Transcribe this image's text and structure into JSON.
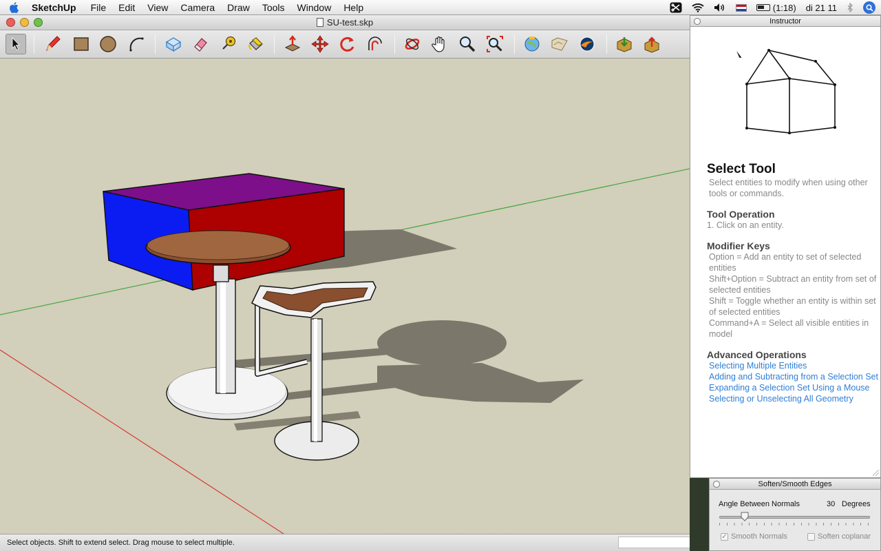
{
  "menubar": {
    "app": "SketchUp",
    "items": [
      "File",
      "Edit",
      "View",
      "Camera",
      "Draw",
      "Tools",
      "Window",
      "Help"
    ],
    "battery": "(1:18)",
    "clock": "di 21 11"
  },
  "window": {
    "title": "SU-test.skp"
  },
  "toolbar": {
    "tools": [
      "Select",
      "Line",
      "Rectangle",
      "Circle",
      "Arc",
      "Make Component",
      "Eraser",
      "Tape Measure",
      "Paint Bucket",
      "Push/Pull",
      "Move",
      "Rotate",
      "Offset",
      "Orbit",
      "Pan",
      "Zoom",
      "Zoom Extents",
      "Get Current View",
      "Toggle Terrain",
      "Place Model",
      "Get Models",
      "Share Model"
    ]
  },
  "status": {
    "text": "Select objects. Shift to extend select. Drag mouse to select multiple."
  },
  "instructor": {
    "panel_title": "Instructor",
    "tool_title": "Select Tool",
    "tool_desc": "Select entities to modify when using other tools or commands.",
    "operation_heading": "Tool Operation",
    "operation_step": "1.  Click on an entity.",
    "modifier_heading": "Modifier Keys",
    "modifiers": [
      "Option = Add an entity to set of selected entities",
      "Shift+Option = Subtract an entity from set of selected entities",
      "Shift = Toggle whether an entity is within set of selected entities",
      "Command+A = Select all visible entities in model"
    ],
    "advanced_heading": "Advanced Operations",
    "links": [
      "Selecting Multiple Entities",
      "Adding and Subtracting from a Selection Set",
      "Expanding a Selection Set Using a Mouse",
      "Selecting or Unselecting All Geometry"
    ]
  },
  "soften": {
    "panel_title": "Soften/Smooth Edges",
    "angle_label": "Angle Between Normals",
    "angle_value": "30",
    "angle_unit": "Degrees",
    "angle_fraction": 0.167,
    "smooth_normals": "Smooth Normals",
    "smooth_checked": true,
    "soften_coplanar": "Soften coplanar",
    "coplanar_checked": false
  },
  "colors": {
    "background": "#d2cfba",
    "box_top": "#7e0f8a",
    "box_left": "#0b1cf2",
    "box_front": "#ad0000",
    "wood": "#8a4f2e",
    "link": "#2e7fd6"
  }
}
